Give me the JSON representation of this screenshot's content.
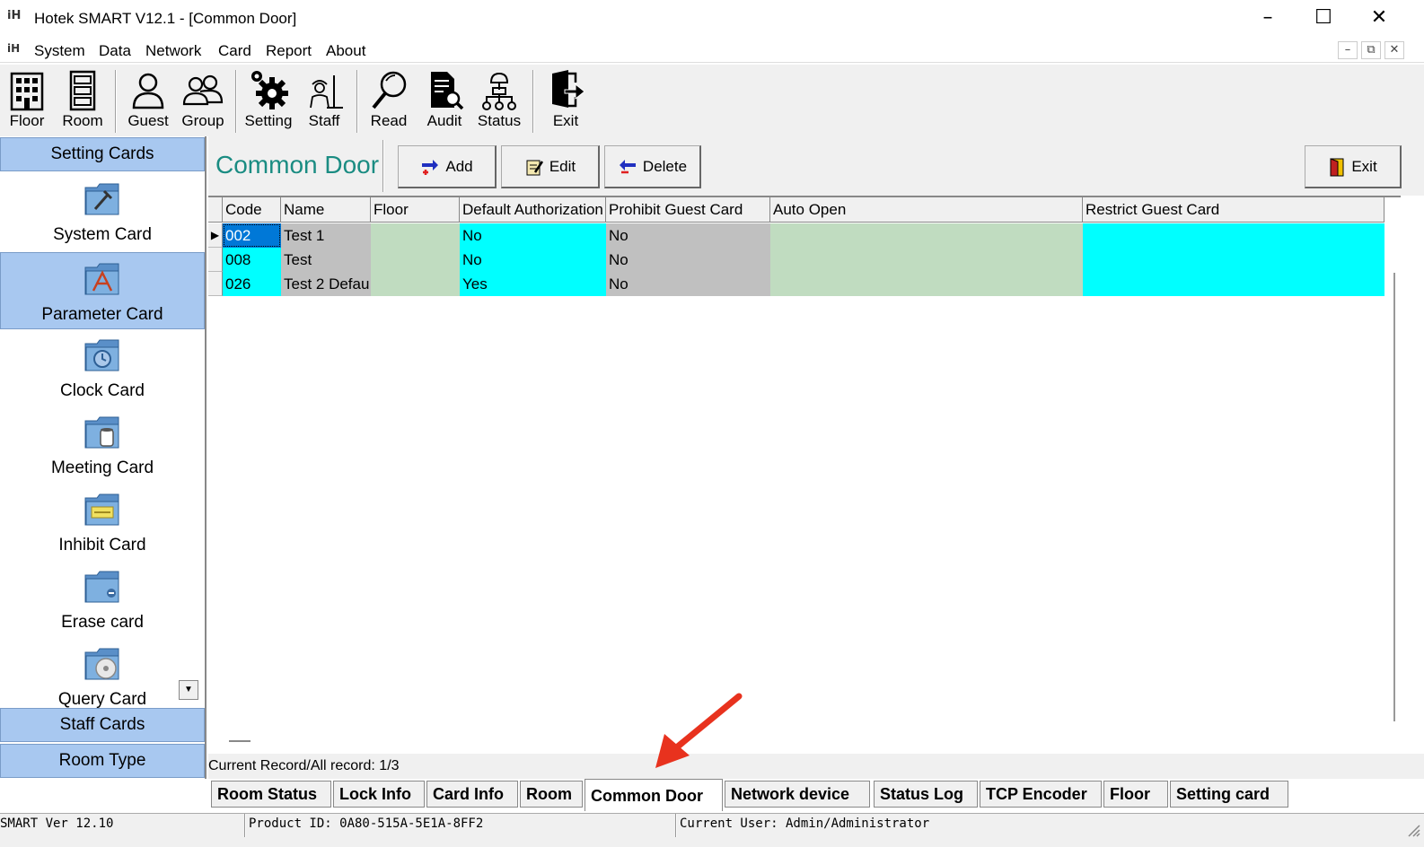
{
  "window": {
    "title": "Hotek SMART V12.1 - [Common Door]",
    "logo": "iH"
  },
  "menu": [
    "System",
    "Data",
    "Network",
    "Card",
    "Report",
    "About"
  ],
  "toolbar": [
    {
      "label": "Floor",
      "icon": "building-icon"
    },
    {
      "label": "Room",
      "icon": "room-icon"
    },
    {
      "label": "Guest",
      "icon": "guest-icon"
    },
    {
      "label": "Group",
      "icon": "group-icon"
    },
    {
      "label": "Setting",
      "icon": "gear-icon"
    },
    {
      "label": "Staff",
      "icon": "staff-icon"
    },
    {
      "label": "Read",
      "icon": "magnifier-icon"
    },
    {
      "label": "Audit",
      "icon": "audit-icon"
    },
    {
      "label": "Status",
      "icon": "network-icon"
    },
    {
      "label": "Exit",
      "icon": "exit-icon"
    }
  ],
  "sidebar": {
    "heading": "Setting Cards",
    "items": [
      "System Card",
      "Parameter Card",
      "Clock Card",
      "Meeting Card",
      "Inhibit Card",
      "Erase card",
      "Query Card"
    ],
    "footer1": "Staff Cards",
    "footer2": "Room Type"
  },
  "page": {
    "title": "Common Door",
    "add": "Add",
    "edit": "Edit",
    "delete": "Delete",
    "exit": "Exit"
  },
  "table": {
    "columns": [
      "Code",
      "Name",
      "Floor",
      "Default Authorization",
      "Prohibit Guest Card",
      "Auto Open",
      "Restrict Guest Card"
    ],
    "rows": [
      [
        "002",
        "Test 1",
        "",
        "No",
        "No",
        "",
        ""
      ],
      [
        "008",
        "Test",
        "",
        "No",
        "No",
        "",
        ""
      ],
      [
        "026",
        "Test 2 Defau",
        "",
        "Yes",
        "No",
        "",
        ""
      ]
    ]
  },
  "record_status": "Current Record/All record: 1/3",
  "tabs": [
    "Room Status",
    "Lock Info",
    "Card Info",
    "Room",
    "Common Door",
    "Network device",
    "Status Log",
    "TCP Encoder",
    "Floor",
    "Setting card"
  ],
  "status": {
    "version": "SMART Ver 12.10",
    "product": "Product ID: 0A80-515A-5E1A-8FF2",
    "user": "Current User: Admin/Administrator"
  },
  "colors": {
    "accent_title": "#1a8c82",
    "sidebar_highlight": "#a8c8f0",
    "cyan": "#00ffff",
    "green": "#c0dcc0",
    "gray": "#c0c0c0",
    "select": "#0078d7",
    "arrow": "#e8321e"
  }
}
